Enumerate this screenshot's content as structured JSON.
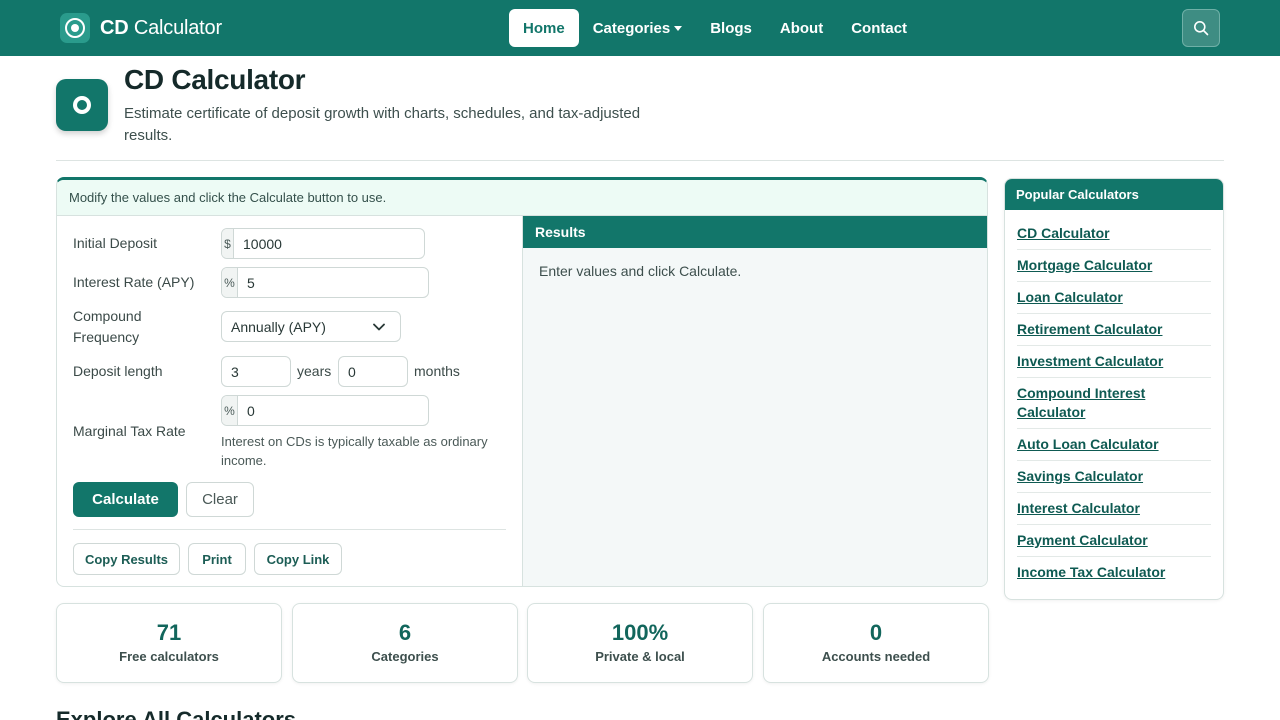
{
  "navbar": {
    "brand_bold": "CD",
    "brand_rest": "Calculator",
    "items": [
      {
        "label": "Home",
        "active": true
      },
      {
        "label": "Categories",
        "dropdown": true
      },
      {
        "label": "Blogs"
      },
      {
        "label": "About"
      },
      {
        "label": "Contact"
      }
    ],
    "search_icon": "search-icon"
  },
  "header": {
    "title": "CD Calculator",
    "subtitle": "Estimate certificate of deposit growth with charts, schedules, and tax-adjusted results."
  },
  "calculator": {
    "hint": "Modify the values and click the Calculate button to use.",
    "initial_deposit": {
      "label": "Initial Deposit",
      "prefix": "$",
      "value": "10000"
    },
    "interest_rate": {
      "label": "Interest Rate (APY)",
      "prefix": "%",
      "value": "5"
    },
    "compound_frequency": {
      "label": "Compound Frequency",
      "selected": "Annually (APY)"
    },
    "deposit_length": {
      "label": "Deposit length",
      "years": "3",
      "years_unit": "years",
      "months": "0",
      "months_unit": "months"
    },
    "tax_rate": {
      "label": "Marginal Tax Rate",
      "prefix": "%",
      "value": "0",
      "help": "Interest on CDs is typically taxable as ordinary income."
    },
    "buttons": {
      "calculate": "Calculate",
      "clear": "Clear",
      "copy_results": "Copy Results",
      "print": "Print",
      "copy_link": "Copy Link"
    }
  },
  "results": {
    "title": "Results",
    "message": "Enter values and click Calculate."
  },
  "sidebar": {
    "title": "Popular Calculators",
    "links": [
      "CD Calculator",
      "Mortgage Calculator",
      "Loan Calculator",
      "Retirement Calculator",
      "Investment Calculator",
      "Compound Interest Calculator",
      "Auto Loan Calculator",
      "Savings Calculator",
      "Interest Calculator",
      "Payment Calculator",
      "Income Tax Calculator"
    ]
  },
  "stats": [
    {
      "value": "71",
      "label": "Free calculators"
    },
    {
      "value": "6",
      "label": "Categories"
    },
    {
      "value": "100%",
      "label": "Private & local"
    },
    {
      "value": "0",
      "label": "Accounts needed"
    }
  ],
  "explore": {
    "title": "Explore All Calculators"
  },
  "colors": {
    "brand": "#12766a",
    "results_bg": "#f4f8f8",
    "hint_bg": "#edfbf5"
  }
}
